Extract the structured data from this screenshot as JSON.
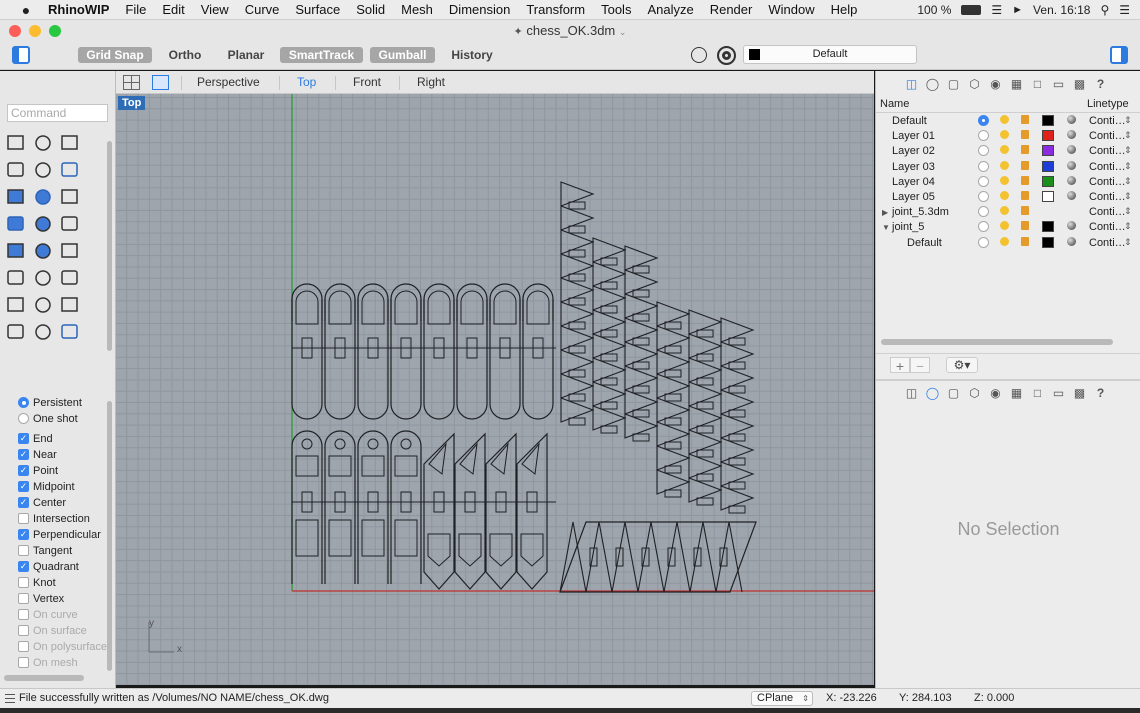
{
  "menubar": {
    "app_name": "RhinoWIP",
    "items": [
      "File",
      "Edit",
      "View",
      "Curve",
      "Surface",
      "Solid",
      "Mesh",
      "Dimension",
      "Transform",
      "Tools",
      "Analyze",
      "Render",
      "Window",
      "Help"
    ],
    "battery": "100 %",
    "clock": "Ven. 16:18"
  },
  "window": {
    "title": "chess_OK.3dm"
  },
  "toolbar": {
    "grid_snap": "Grid Snap",
    "ortho": "Ortho",
    "planar": "Planar",
    "smarttrack": "SmartTrack",
    "gumball": "Gumball",
    "history": "History",
    "current_layer": "Default"
  },
  "command": {
    "placeholder": "Command"
  },
  "viewport_tabs": [
    "Perspective",
    "Top",
    "Front",
    "Right"
  ],
  "active_viewport": "Top",
  "osnaps": {
    "mode_persistent": "Persistent",
    "mode_oneshot": "One shot",
    "items": [
      {
        "label": "End",
        "checked": true,
        "enabled": true
      },
      {
        "label": "Near",
        "checked": true,
        "enabled": true
      },
      {
        "label": "Point",
        "checked": true,
        "enabled": true
      },
      {
        "label": "Midpoint",
        "checked": true,
        "enabled": true
      },
      {
        "label": "Center",
        "checked": true,
        "enabled": true
      },
      {
        "label": "Intersection",
        "checked": false,
        "enabled": true
      },
      {
        "label": "Perpendicular",
        "checked": true,
        "enabled": true
      },
      {
        "label": "Tangent",
        "checked": false,
        "enabled": true
      },
      {
        "label": "Quadrant",
        "checked": true,
        "enabled": true
      },
      {
        "label": "Knot",
        "checked": false,
        "enabled": true
      },
      {
        "label": "Vertex",
        "checked": false,
        "enabled": true
      },
      {
        "label": "On curve",
        "checked": false,
        "enabled": false
      },
      {
        "label": "On surface",
        "checked": false,
        "enabled": false
      },
      {
        "label": "On polysurface",
        "checked": false,
        "enabled": false
      },
      {
        "label": "On mesh",
        "checked": false,
        "enabled": false
      }
    ]
  },
  "layers": {
    "col_name": "Name",
    "col_linetype": "Linetype",
    "rows": [
      {
        "name": "Default",
        "color": "#000000",
        "linetype": "Conti…",
        "current": true,
        "indent": 0
      },
      {
        "name": "Layer 01",
        "color": "#e0201a",
        "linetype": "Conti…",
        "current": false,
        "indent": 0
      },
      {
        "name": "Layer 02",
        "color": "#8a2be2",
        "linetype": "Conti…",
        "current": false,
        "indent": 0
      },
      {
        "name": "Layer 03",
        "color": "#1f3ed8",
        "linetype": "Conti…",
        "current": false,
        "indent": 0
      },
      {
        "name": "Layer 04",
        "color": "#1a8f1a",
        "linetype": "Conti…",
        "current": false,
        "indent": 0
      },
      {
        "name": "Layer 05",
        "color": "#ffffff",
        "linetype": "Conti…",
        "current": false,
        "indent": 0
      },
      {
        "name": "joint_5.3dm",
        "color": "",
        "linetype": "Conti…",
        "current": false,
        "indent": 0,
        "expander": "▶"
      },
      {
        "name": "joint_5",
        "color": "#000000",
        "linetype": "Conti…",
        "current": false,
        "indent": 0,
        "expander": "▼"
      },
      {
        "name": "Default",
        "color": "#000000",
        "linetype": "Conti…",
        "current": false,
        "indent": 1
      }
    ]
  },
  "properties": {
    "empty_text": "No Selection"
  },
  "status": {
    "message": "File successfully written as /Volumes/NO NAME/chess_OK.dwg",
    "cplane": "CPlane",
    "x": "X: -23.226",
    "y": "Y: 284.103",
    "z": "Z: 0.000"
  },
  "axis": {
    "x_label": "x",
    "y_label": "y"
  }
}
